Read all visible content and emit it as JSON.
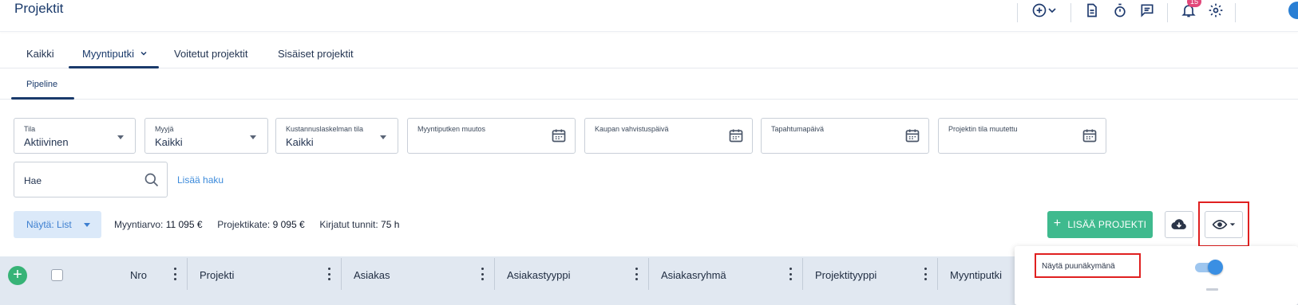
{
  "header": {
    "title": "Projektit",
    "notifications_count": "15",
    "icons": [
      "add-circle-icon",
      "chevron-down-icon",
      "document-icon",
      "stopwatch-icon",
      "chat-icon",
      "bell-icon",
      "gear-icon"
    ]
  },
  "tabs": [
    {
      "label": "Kaikki"
    },
    {
      "label": "Myyntiputki"
    },
    {
      "label": "Voitetut projektit"
    },
    {
      "label": "Sisäiset projektit"
    }
  ],
  "subtabs": [
    {
      "label": "Pipeline"
    }
  ],
  "filters": {
    "tila": {
      "label": "Tila",
      "value": "Aktiivinen"
    },
    "myyja": {
      "label": "Myyjä",
      "value": "Kaikki"
    },
    "kustannus": {
      "label": "Kustannuslaskelman tila",
      "value": "Kaikki"
    },
    "myyntiputken_muutos": {
      "label": "Myyntiputken muutos"
    },
    "kaupan_vahvistus": {
      "label": "Kaupan vahvistuspäivä"
    },
    "tapahtuma": {
      "label": "Tapahtumapäivä"
    },
    "tila_muutettu": {
      "label": "Projektin tila muutettu"
    }
  },
  "search": {
    "value": "Hae",
    "more_label": "Lisää haku"
  },
  "toolbar": {
    "show_label": "Näytä: List",
    "sales_value_label": "Myyntiarvo:",
    "sales_value": "11 095 €",
    "margin_label": "Projektikate:",
    "margin_value": "9 095 €",
    "hours_label": "Kirjatut tunnit:",
    "hours_value": "75 h",
    "add_project_label": "LISÄÄ PROJEKTI"
  },
  "table": {
    "columns": [
      "Nro",
      "Projekti",
      "Asiakas",
      "Asiakastyyppi",
      "Asiakasryhmä",
      "Projektityyppi",
      "Myyntiputki"
    ]
  },
  "popup": {
    "tree_view_label": "Näytä puunäkymänä",
    "tree_view_enabled": true
  },
  "colors": {
    "primary": "#1a3a6b",
    "accent_green": "#3fba8e",
    "accent_blue": "#3d8bdb",
    "highlight_red": "#e02020"
  }
}
